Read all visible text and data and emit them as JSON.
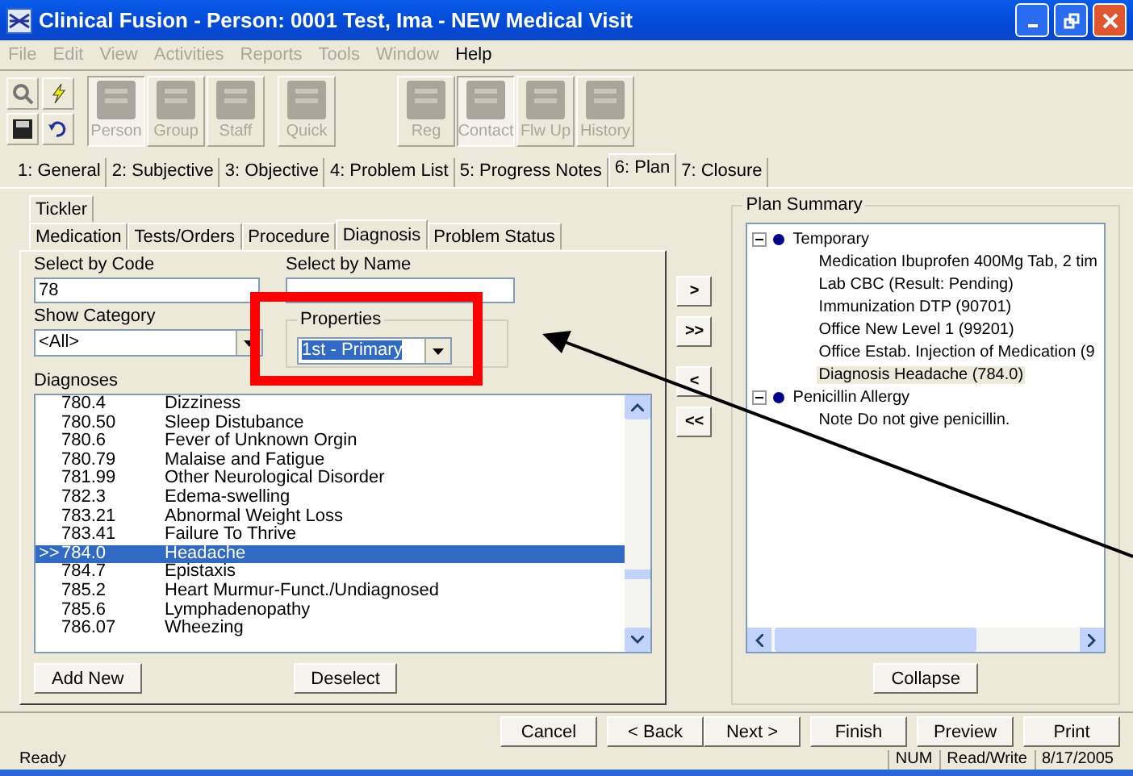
{
  "window": {
    "title": "Clinical Fusion - Person: 0001 Test, Ima -  NEW Medical Visit"
  },
  "menu": [
    {
      "label": "File",
      "disabled": true
    },
    {
      "label": "Edit",
      "disabled": true
    },
    {
      "label": "View",
      "disabled": true
    },
    {
      "label": "Activities",
      "disabled": true
    },
    {
      "label": "Reports",
      "disabled": true
    },
    {
      "label": "Tools",
      "disabled": true
    },
    {
      "label": "Window",
      "disabled": true
    },
    {
      "label": "Help",
      "disabled": false
    }
  ],
  "toolbar": [
    [
      {
        "label": "Person",
        "pressed": true
      },
      {
        "label": "Group",
        "pressed": false
      },
      {
        "label": "Staff",
        "pressed": false
      }
    ],
    [
      {
        "label": "Quick",
        "pressed": false
      }
    ],
    [
      {
        "label": "Reg",
        "pressed": false
      },
      {
        "label": "Contact",
        "pressed": true
      },
      {
        "label": "Flw Up",
        "pressed": false
      },
      {
        "label": "History",
        "pressed": false
      }
    ]
  ],
  "tabs": [
    {
      "label": "1: General",
      "selected": false
    },
    {
      "label": "2: Subjective",
      "selected": false
    },
    {
      "label": "3: Objective",
      "selected": false
    },
    {
      "label": "4: Problem List",
      "selected": false
    },
    {
      "label": "5: Progress Notes",
      "selected": false
    },
    {
      "label": "6: Plan",
      "selected": true
    },
    {
      "label": "7: Closure",
      "selected": false
    }
  ],
  "top_tabs": [
    {
      "label": "Tickler",
      "selected": false
    }
  ],
  "sub_tabs": [
    {
      "label": "Medication",
      "selected": false
    },
    {
      "label": "Tests/Orders",
      "selected": false
    },
    {
      "label": "Procedure",
      "selected": false
    },
    {
      "label": "Diagnosis",
      "selected": true
    },
    {
      "label": "Problem Status",
      "selected": false
    }
  ],
  "select_by_code": {
    "label": "Select by Code",
    "value": "78"
  },
  "select_by_name": {
    "label": "Select by Name"
  },
  "show_category": {
    "label": "Show Category",
    "value": "<All>"
  },
  "properties": {
    "label": "Properties",
    "value": "1st - Primary"
  },
  "diagnoses": {
    "label": "Diagnoses",
    "rows": [
      {
        "code": "780.4",
        "name": "Dizziness",
        "selected": false
      },
      {
        "code": "780.50",
        "name": "Sleep Distubance",
        "selected": false
      },
      {
        "code": "780.6",
        "name": "Fever of Unknown Orgin",
        "selected": false
      },
      {
        "code": "780.79",
        "name": "Malaise and Fatigue",
        "selected": false
      },
      {
        "code": "781.99",
        "name": "Other Neurological Disorder",
        "selected": false
      },
      {
        "code": "782.3",
        "name": "Edema-swelling",
        "selected": false
      },
      {
        "code": "783.21",
        "name": "Abnormal Weight Loss",
        "selected": false
      },
      {
        "code": "783.41",
        "name": "Failure To Thrive",
        "selected": false
      },
      {
        "code": "784.0",
        "name": "Headache",
        "selected": true,
        "marker": ">>"
      },
      {
        "code": "784.7",
        "name": "Epistaxis",
        "selected": false
      },
      {
        "code": "785.2",
        "name": "Heart Murmur-Funct./Undiagnosed",
        "selected": false
      },
      {
        "code": "785.6",
        "name": "Lymphadenopathy",
        "selected": false
      },
      {
        "code": "786.07",
        "name": "Wheezing",
        "selected": false
      }
    ]
  },
  "list_buttons": [
    "Add New",
    "Deselect"
  ],
  "move_buttons": [
    ">",
    ">>",
    "<",
    "<<"
  ],
  "plan_summary": {
    "label": "Plan Summary",
    "tree": [
      {
        "label": "Temporary",
        "expanded": true,
        "children": [
          {
            "label": "Medication Ibuprofen 400Mg Tab, 2 tim",
            "selected": false
          },
          {
            "label": "Lab CBC (Result: Pending)",
            "selected": false
          },
          {
            "label": "Immunization DTP (90701)",
            "selected": false
          },
          {
            "label": "Office New Level 1 (99201)",
            "selected": false
          },
          {
            "label": "Office Estab. Injection of Medication (9",
            "selected": false
          },
          {
            "label": "Diagnosis Headache (784.0)",
            "selected": true
          }
        ]
      },
      {
        "label": "Penicillin Allergy",
        "expanded": true,
        "children": [
          {
            "label": "Note Do not give penicillin.",
            "selected": false
          }
        ]
      }
    ],
    "button": "Collapse"
  },
  "wizard_buttons": [
    "Cancel",
    "< Back",
    "Next >",
    "Finish",
    "Preview",
    "Print"
  ],
  "status_bar": [
    "Ready",
    "NUM",
    "Read/Write",
    "8/17/2005"
  ]
}
